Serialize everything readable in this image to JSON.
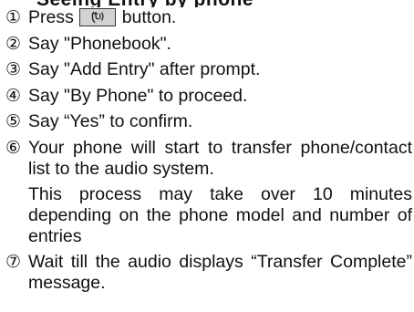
{
  "top_cutoff_text": "Seeing Entry by phone",
  "steps": [
    {
      "num": "①",
      "before": "Press",
      "button_icon": "voice-talk-icon",
      "after": "button."
    },
    {
      "num": "②",
      "text": "Say \"Phonebook\"."
    },
    {
      "num": "③",
      "text": "Say \"Add Entry\" after prompt."
    },
    {
      "num": "④",
      "text": "Say \"By Phone\" to proceed."
    },
    {
      "num": "⑤",
      "text": "Say “Yes” to confirm."
    },
    {
      "num": "⑥",
      "text": "Your phone will start to transfer phone/contact list to the audio system.",
      "text2": "This process may take over 10 minutes depending on the phone model and number of entries"
    },
    {
      "num": "⑦",
      "text": "Wait till the audio displays “Transfer Complete” message."
    }
  ]
}
